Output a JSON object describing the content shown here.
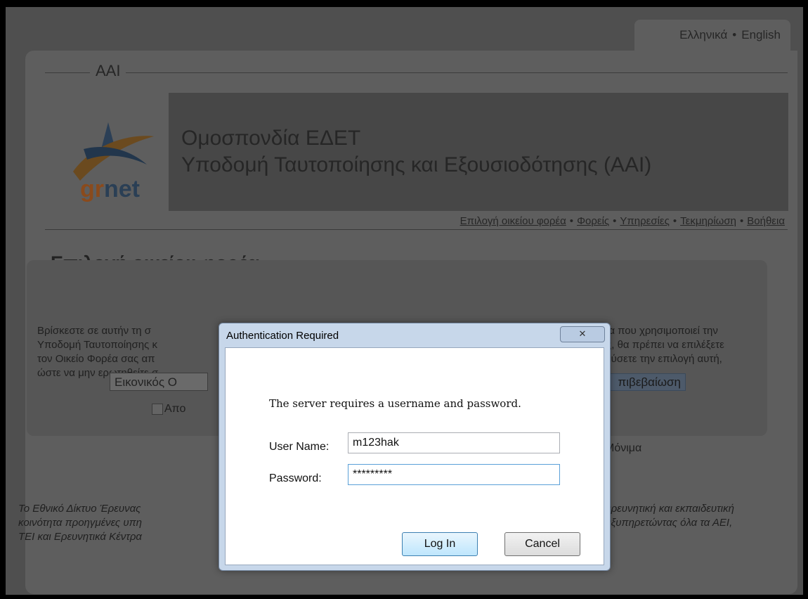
{
  "language_switch": {
    "greek": "Ελληνικά",
    "separator": "•",
    "english": "English"
  },
  "site": {
    "section_label": "AAI",
    "logo_text_gr": "gr",
    "logo_text_net": "net",
    "title_line1": "Ομοσπονδία ΕΔΕΤ",
    "title_line2": "Υποδομή Ταυτοποίησης και Εξουσιοδότησης (AAI)"
  },
  "nav": {
    "items": [
      "Επιλογή οικείου φορέα",
      "Φορείς",
      "Υπηρεσίες",
      "Τεκμηρίωση",
      "Βοήθεια"
    ],
    "separator": "•"
  },
  "page": {
    "title": "Επιλογή οικείου φορέα",
    "intro_left": [
      "Βρίσκεστε σε αυτήν τη σ",
      "Υποδομή Ταυτοποίησης κ",
      "τον Οικείο Φορέα σας απ",
      "ώστε να μην ερωτηθείτε σ"
    ],
    "intro_right": [
      "ία που χρησιμοποιεί την",
      "ς, θα πρέπει να επιλέξετε",
      "εύσετε την επιλογή αυτή,"
    ],
    "select_value": "Εικονικός Ο",
    "confirm_label": "πιβεβαίωση",
    "checkbox_label_left": "Απο",
    "checkbox_label_right": "Μόνιμα",
    "footer_left": [
      "Το Εθνικό Δίκτυο Έρευνας",
      "κοινότητα προηγμένες υπη",
      "ΤΕΙ και Ερευνητικά Κέντρα"
    ],
    "footer_right": [
      "ερευνητική και εκπαιδευτική",
      "εξυπηρετώντας όλα τα ΑΕΙ,"
    ]
  },
  "dialog": {
    "title": "Authentication Required",
    "close_glyph": "✕",
    "message": "The server requires a username and password.",
    "user_label": "User Name:",
    "user_value": "m123hak",
    "password_label": "Password:",
    "password_value": "*********",
    "login_label": "Log In",
    "cancel_label": "Cancel"
  },
  "colors": {
    "logo_arc_orange": "#8a5a1e",
    "logo_arc_blue": "#1e3a5a",
    "dialog_chrome": "#c7d7ea"
  }
}
